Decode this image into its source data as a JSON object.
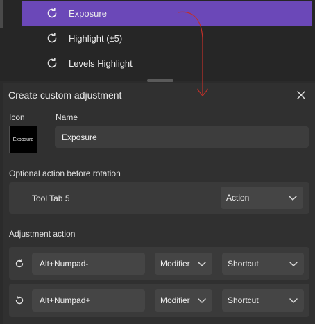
{
  "list": {
    "items": [
      {
        "label": "Exposure",
        "icon": "rotate-icon",
        "selected": true
      },
      {
        "label": "Highlight (±5)",
        "icon": "rotate-icon",
        "selected": false
      },
      {
        "label": "Levels Highlight",
        "icon": "rotate-icon",
        "selected": false
      }
    ]
  },
  "dialog": {
    "title": "Create custom adjustment",
    "icon_label": "Icon",
    "icon_preview_text": "Exposure",
    "name_label": "Name",
    "name_value": "Exposure",
    "optional_action_label": "Optional action before rotation",
    "optional_action": {
      "tool": "Tool Tab 5",
      "type": "Action"
    },
    "adjustment_label": "Adjustment action",
    "adjustments": [
      {
        "direction_icon": "rotate-clockwise-icon",
        "key": "Alt+Numpad-",
        "modifier": "Modifier",
        "type": "Shortcut"
      },
      {
        "direction_icon": "rotate-counterclockwise-icon",
        "key": "Alt+Numpad+",
        "modifier": "Modifier",
        "type": "Shortcut"
      }
    ]
  },
  "colors": {
    "selected_row": "#6b48b8",
    "annotation_arrow": "#c0302a",
    "panel_bg": "#303030"
  }
}
